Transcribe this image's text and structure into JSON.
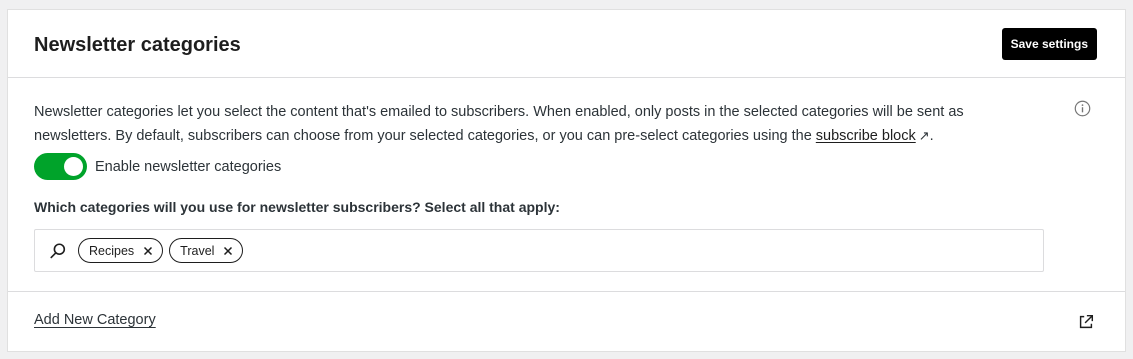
{
  "header": {
    "title": "Newsletter categories",
    "save_label": "Save settings"
  },
  "description": {
    "text": "Newsletter categories let you select the content that's emailed to subscribers. When enabled, only posts in the selected categories will be sent as newsletters. By default, subscribers can choose from your selected categories, or you can pre-select categories using the ",
    "link_label": "subscribe block",
    "link_suffix": "↗",
    "end": "."
  },
  "toggle": {
    "label": "Enable newsletter categories",
    "enabled": true
  },
  "categories": {
    "question": "Which categories will you use for newsletter subscribers? Select all that apply:",
    "tokens": [
      "Recipes",
      "Travel"
    ]
  },
  "footer": {
    "add_label": "Add New Category"
  },
  "colors": {
    "accent": "#00a32a",
    "primary_button": "#000000",
    "background": "#f0f0f1"
  },
  "icons": [
    "info-icon",
    "search-icon",
    "close-icon",
    "external-link-icon"
  ]
}
